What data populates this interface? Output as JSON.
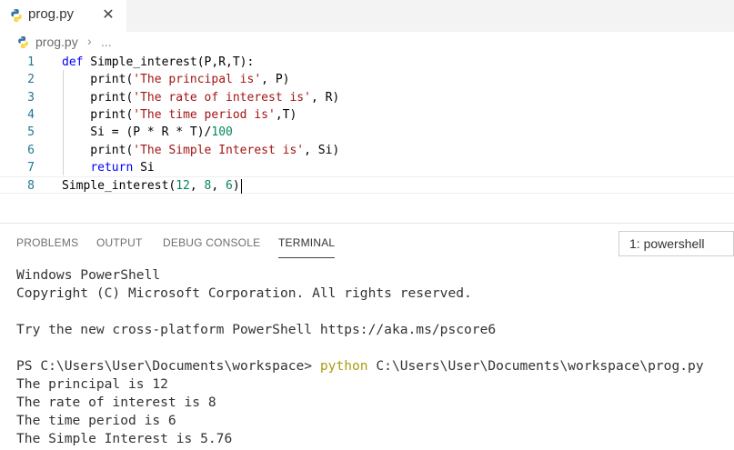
{
  "tab": {
    "filename": "prog.py",
    "close_glyph": "✕"
  },
  "breadcrumb": {
    "file": "prog.py",
    "separator": "›",
    "more": "..."
  },
  "editor": {
    "lines": [
      {
        "num": "1",
        "tokens": [
          {
            "t": "def",
            "c": "kw"
          },
          {
            "t": " Simple_interest(P,R,T):",
            "c": ""
          }
        ]
      },
      {
        "num": "2",
        "tokens": [
          {
            "t": "    print(",
            "c": ""
          },
          {
            "t": "'The principal is'",
            "c": "str"
          },
          {
            "t": ", P)",
            "c": ""
          }
        ]
      },
      {
        "num": "3",
        "tokens": [
          {
            "t": "    print(",
            "c": ""
          },
          {
            "t": "'The rate of interest is'",
            "c": "str"
          },
          {
            "t": ", R)",
            "c": ""
          }
        ]
      },
      {
        "num": "4",
        "tokens": [
          {
            "t": "    print(",
            "c": ""
          },
          {
            "t": "'The time period is'",
            "c": "str"
          },
          {
            "t": ",T)",
            "c": ""
          }
        ]
      },
      {
        "num": "5",
        "tokens": [
          {
            "t": "    Si = (P * R * T)/",
            "c": ""
          },
          {
            "t": "100",
            "c": "num"
          }
        ]
      },
      {
        "num": "6",
        "tokens": [
          {
            "t": "    print(",
            "c": ""
          },
          {
            "t": "'The Simple Interest is'",
            "c": "str"
          },
          {
            "t": ", Si)",
            "c": ""
          }
        ]
      },
      {
        "num": "7",
        "tokens": [
          {
            "t": "    ",
            "c": ""
          },
          {
            "t": "return",
            "c": "kw"
          },
          {
            "t": " Si",
            "c": ""
          }
        ]
      },
      {
        "num": "8",
        "tokens": [
          {
            "t": "Simple_interest(",
            "c": ""
          },
          {
            "t": "12",
            "c": "num"
          },
          {
            "t": ", ",
            "c": ""
          },
          {
            "t": "8",
            "c": "num"
          },
          {
            "t": ", ",
            "c": ""
          },
          {
            "t": "6",
            "c": "num"
          },
          {
            "t": ")",
            "c": ""
          }
        ]
      }
    ]
  },
  "panel": {
    "tabs": [
      "PROBLEMS",
      "OUTPUT",
      "DEBUG CONSOLE",
      "TERMINAL"
    ],
    "active_tab": "TERMINAL",
    "terminal_select": "1: powershell"
  },
  "terminal": {
    "lines": [
      "Windows PowerShell",
      "Copyright (C) Microsoft Corporation. All rights reserved.",
      "",
      "Try the new cross-platform PowerShell https://aka.ms/pscore6",
      "",
      "PS_PROMPT",
      "The principal is 12",
      "The rate of interest is 8",
      "The time period is 6",
      "The Simple Interest is 5.76"
    ],
    "prompt": "PS C:\\Users\\User\\Documents\\workspace> ",
    "command": "python",
    "command_args": " C:\\Users\\User\\Documents\\workspace\\prog.py"
  },
  "colors": {
    "keyword": "#0000ff",
    "string": "#a31515",
    "number": "#098658",
    "line_number": "#237893",
    "command": "#a8a012",
    "python_icon_blue": "#3572A5",
    "python_icon_yellow": "#FFD43B"
  },
  "icons": {
    "tab_icon": "python-file-icon",
    "breadcrumb_icon": "python-file-icon"
  }
}
